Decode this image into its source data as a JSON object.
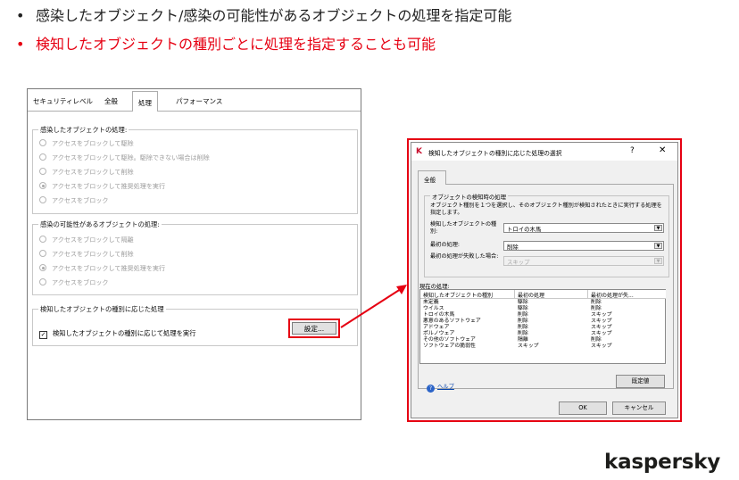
{
  "bullets": [
    "感染したオブジェクト/感染の可能性があるオブジェクトの処理を指定可能",
    "検知したオブジェクトの種別ごとに処理を指定することも可能"
  ],
  "bullet_mark": "•",
  "settings_dialog": {
    "tabs": [
      "セキュリティレベル",
      "全般",
      "処理",
      "パフォーマンス"
    ],
    "selected_tab": "処理",
    "infected_group": {
      "title": "感染したオブジェクトの処理:",
      "options": [
        "アクセスをブロックして駆除",
        "アクセスをブロックして駆除。駆除できない場合は削除",
        "アクセスをブロックして削除",
        "アクセスをブロックして推奨処理を実行",
        "アクセスをブロック"
      ],
      "selected_index": 3
    },
    "suspicious_group": {
      "title": "感染の可能性があるオブジェクトの処理:",
      "options": [
        "アクセスをブロックして隔離",
        "アクセスをブロックして削除",
        "アクセスをブロックして推奨処理を実行",
        "アクセスをブロック"
      ],
      "selected_index": 2
    },
    "type_group": {
      "title": "検知したオブジェクトの種別に応じた処理",
      "checkbox_label": "検知したオブジェクトの種別に応じて処理を実行",
      "checked": true,
      "settings_button": "設定..."
    }
  },
  "type_dialog": {
    "logo_letter": "K",
    "title": "検知したオブジェクトの種別に応じた処理の選択",
    "help_button": "?",
    "close_button": "✕",
    "tab": "全般",
    "group_title": "オブジェクトの検知時の処理",
    "description": "オブジェクト種別を１つを選択し、そのオブジェクト種別が検知されたときに実行する処理を指定します。",
    "type_label": "検知したオブジェクトの種別:",
    "type_value": "トロイの木馬",
    "first_action_label": "最初の処理:",
    "first_action_value": "削除",
    "fallback_label": "最初の処理が失敗した場合:",
    "fallback_value": "スキップ",
    "current_label": "現在の処理:",
    "columns": [
      "検知したオブジェクトの種別",
      "最初の処理",
      "最初の処理が失..."
    ],
    "rows": [
      [
        "未定義",
        "駆除",
        "削除"
      ],
      [
        "ウイルス",
        "駆除",
        "削除"
      ],
      [
        "トロイの木馬",
        "削除",
        "スキップ"
      ],
      [
        "悪意のあるソフトウェア",
        "削除",
        "スキップ"
      ],
      [
        "アドウェア",
        "削除",
        "スキップ"
      ],
      [
        "ポルノウェア",
        "削除",
        "スキップ"
      ],
      [
        "その他のソフトウェア",
        "隔離",
        "削除"
      ],
      [
        "ソフトウェアの脆弱性",
        "スキップ",
        "スキップ"
      ]
    ],
    "default_button": "既定値",
    "help_link": "ヘルプ",
    "ok_button": "OK",
    "cancel_button": "キャンセル"
  },
  "brand": "kaspersky",
  "colors": {
    "highlight": "#e60012",
    "brand": "#1d1d1b"
  }
}
